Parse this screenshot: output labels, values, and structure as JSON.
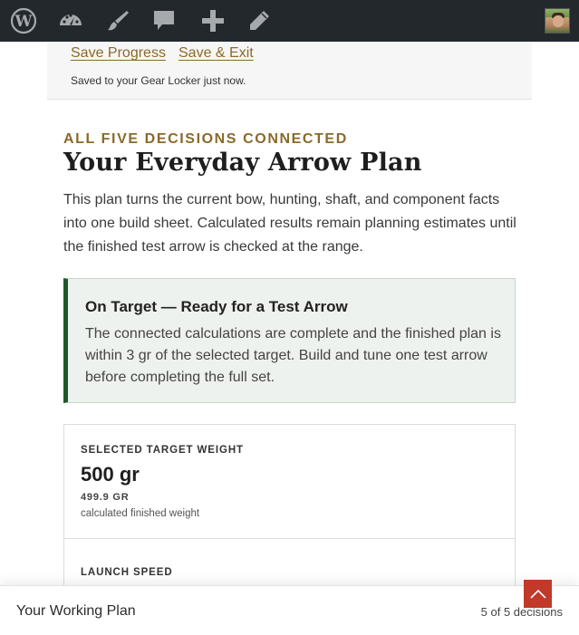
{
  "adminbar": {
    "icons": [
      "wordpress-logo-icon",
      "dashboard-icon",
      "customize-brush-icon",
      "comments-icon",
      "new-content-plus-icon",
      "edit-pencil-icon"
    ]
  },
  "save_panel": {
    "save_progress_label": "Save Progress",
    "save_exit_label": "Save & Exit",
    "status": "Saved to your Gear Locker just now."
  },
  "plan": {
    "eyebrow": "ALL FIVE DECISIONS CONNECTED",
    "title": "Your Everyday Arrow Plan",
    "intro": "This plan turns the current bow, hunting, shaft, and component facts into one build sheet. Calculated results remain planning estimates until the finished test arrow is checked at the range."
  },
  "notice": {
    "title": "On Target — Ready for a Test Arrow",
    "body": "The connected calculations are complete and the finished plan is within 3 gr of the selected target. Build and tune one test arrow before completing the full set.",
    "accent_color": "#1f5a2a"
  },
  "metrics": [
    {
      "label": "SELECTED TARGET WEIGHT",
      "value": "500 gr",
      "sub_value": "499.9 GR",
      "note": "calculated finished weight"
    },
    {
      "label": "LAUNCH SPEED"
    }
  ],
  "footer": {
    "title": "Your Working Plan",
    "progress": "5 of 5 decisions"
  },
  "colors": {
    "adminbar_bg": "#23282d",
    "gold_accent": "#8a6a2a",
    "scroll_top_bg": "#c0392b"
  }
}
